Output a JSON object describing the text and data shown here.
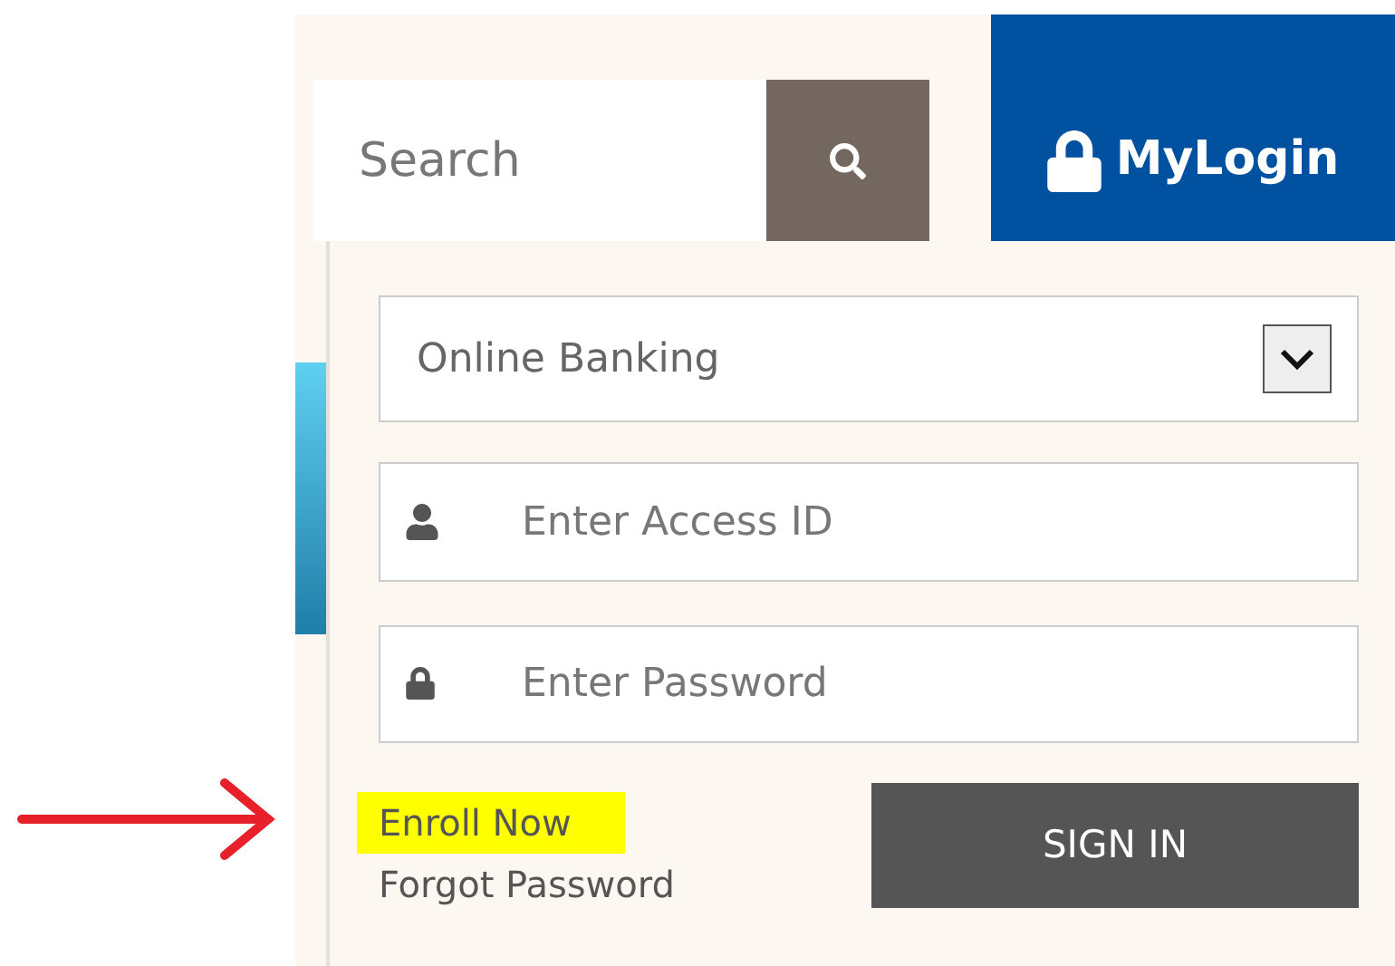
{
  "search": {
    "placeholder": "Search"
  },
  "login_button": {
    "label": "MyLogin"
  },
  "login_panel": {
    "account_type": {
      "value": "Online Banking"
    },
    "access_id": {
      "placeholder": "Enter Access ID"
    },
    "password": {
      "placeholder": "Enter Password"
    },
    "links": [
      {
        "label": "Enroll Now",
        "highlighted": true
      },
      {
        "label": "Forgot Password",
        "highlighted": false
      }
    ],
    "sign_in_button": {
      "label": "SIGN IN"
    }
  }
}
